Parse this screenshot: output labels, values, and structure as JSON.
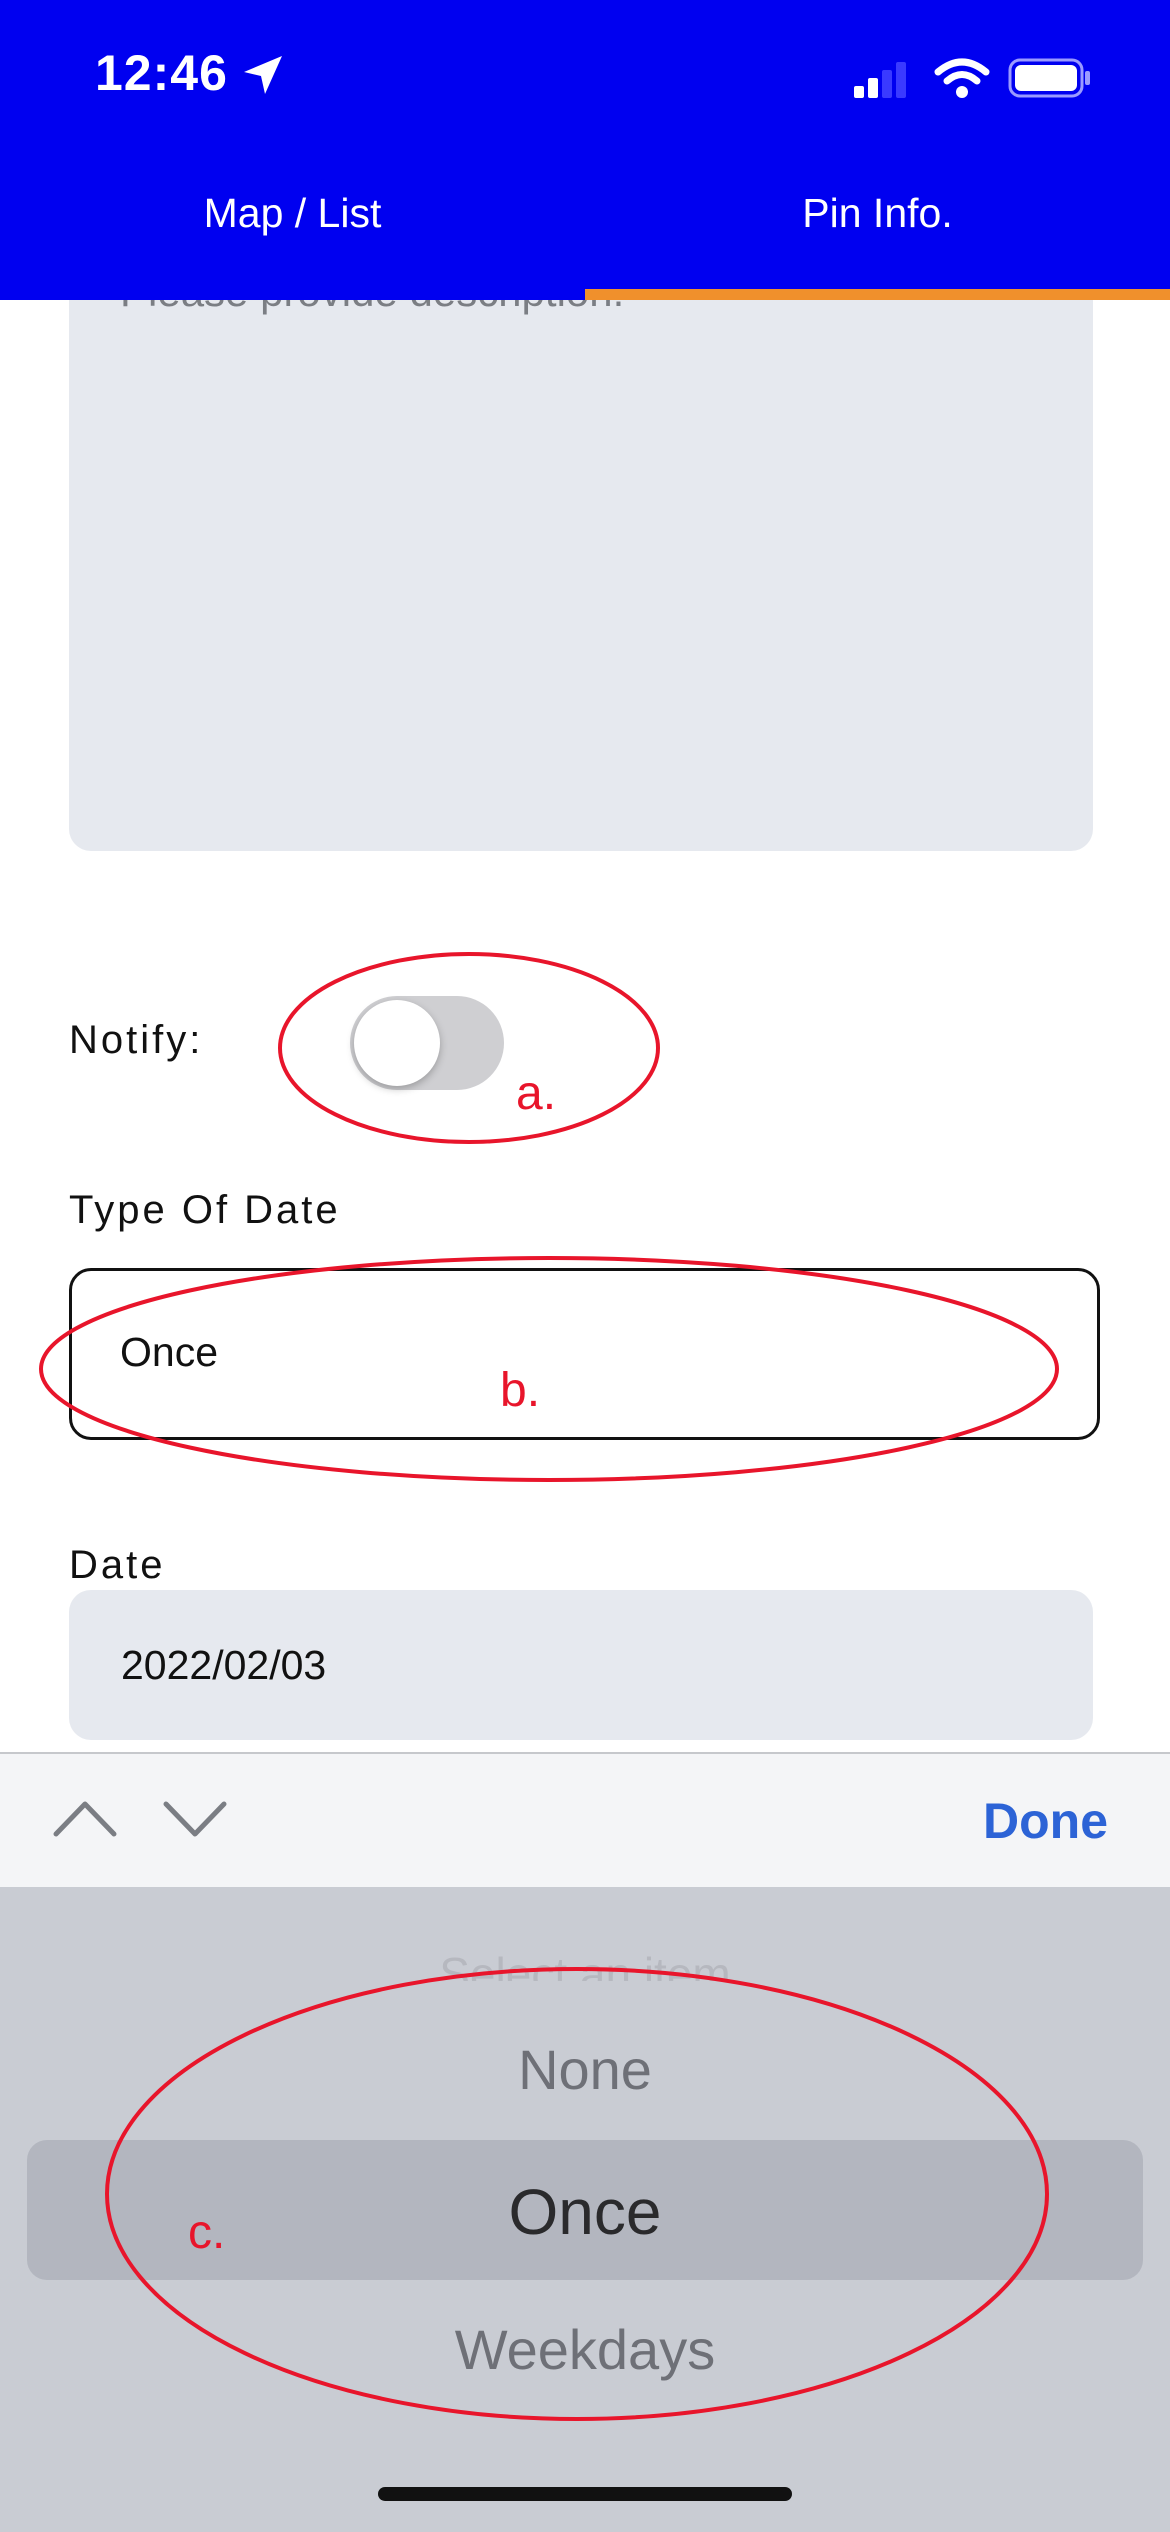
{
  "status_bar": {
    "time": "12:46"
  },
  "tabs": [
    {
      "label": "Map / List"
    },
    {
      "label": "Pin Info."
    }
  ],
  "description": {
    "placeholder": "Please provide description."
  },
  "notify": {
    "label": "Notify:",
    "on": false
  },
  "type_of_date": {
    "label": "Type Of Date",
    "value": "Once"
  },
  "date": {
    "label": "Date",
    "value": "2022/02/03"
  },
  "keyboard_toolbar": {
    "done_label": "Done"
  },
  "picker": {
    "placeholder": "Select an item",
    "items": [
      "None",
      "Once",
      "Weekdays"
    ],
    "selected": "Once"
  },
  "annotations": {
    "a": "a.",
    "b": "b.",
    "c": "c."
  },
  "colors": {
    "header": "#0000f0",
    "tab_indicator": "#f0902c",
    "annotation": "#e8152b",
    "done": "#2c63d6"
  }
}
